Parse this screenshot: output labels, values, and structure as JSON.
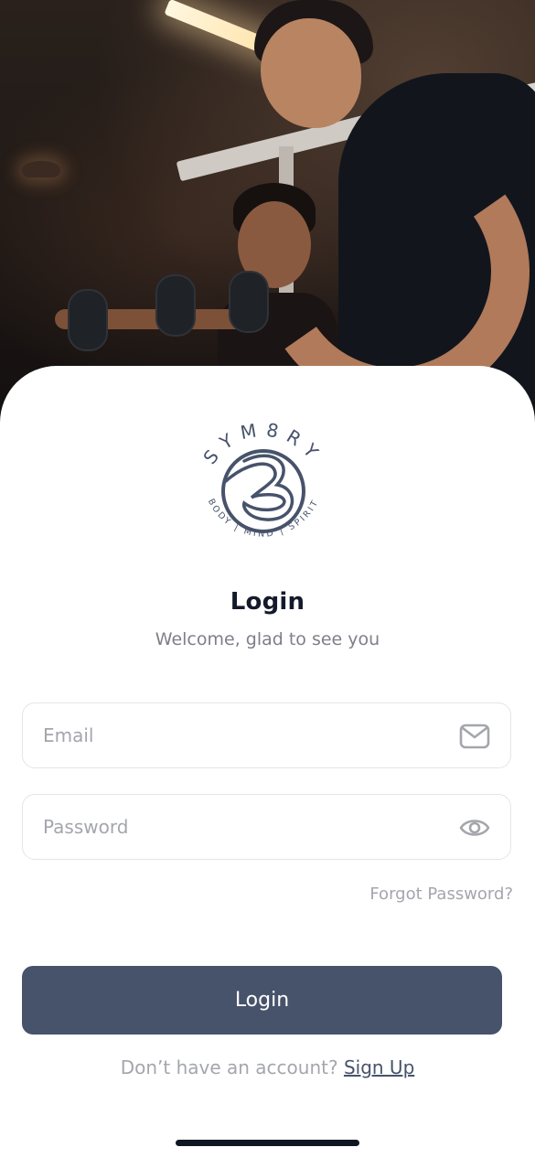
{
  "brand": {
    "ring_text": "SYM8RY",
    "tagline": "BODY | MIND | SPIRIT",
    "accent_color": "#47536b"
  },
  "login": {
    "title": "Login",
    "subtitle": "Welcome, glad to see you",
    "email": {
      "placeholder": "Email",
      "value": "",
      "icon": "mail-icon"
    },
    "password": {
      "placeholder": "Password",
      "value": "",
      "icon": "eye-icon"
    },
    "forgot_label": "Forgot Password?",
    "submit_label": "Login",
    "signup_prompt": "Don’t have an account?",
    "signup_link": "Sign Up"
  }
}
